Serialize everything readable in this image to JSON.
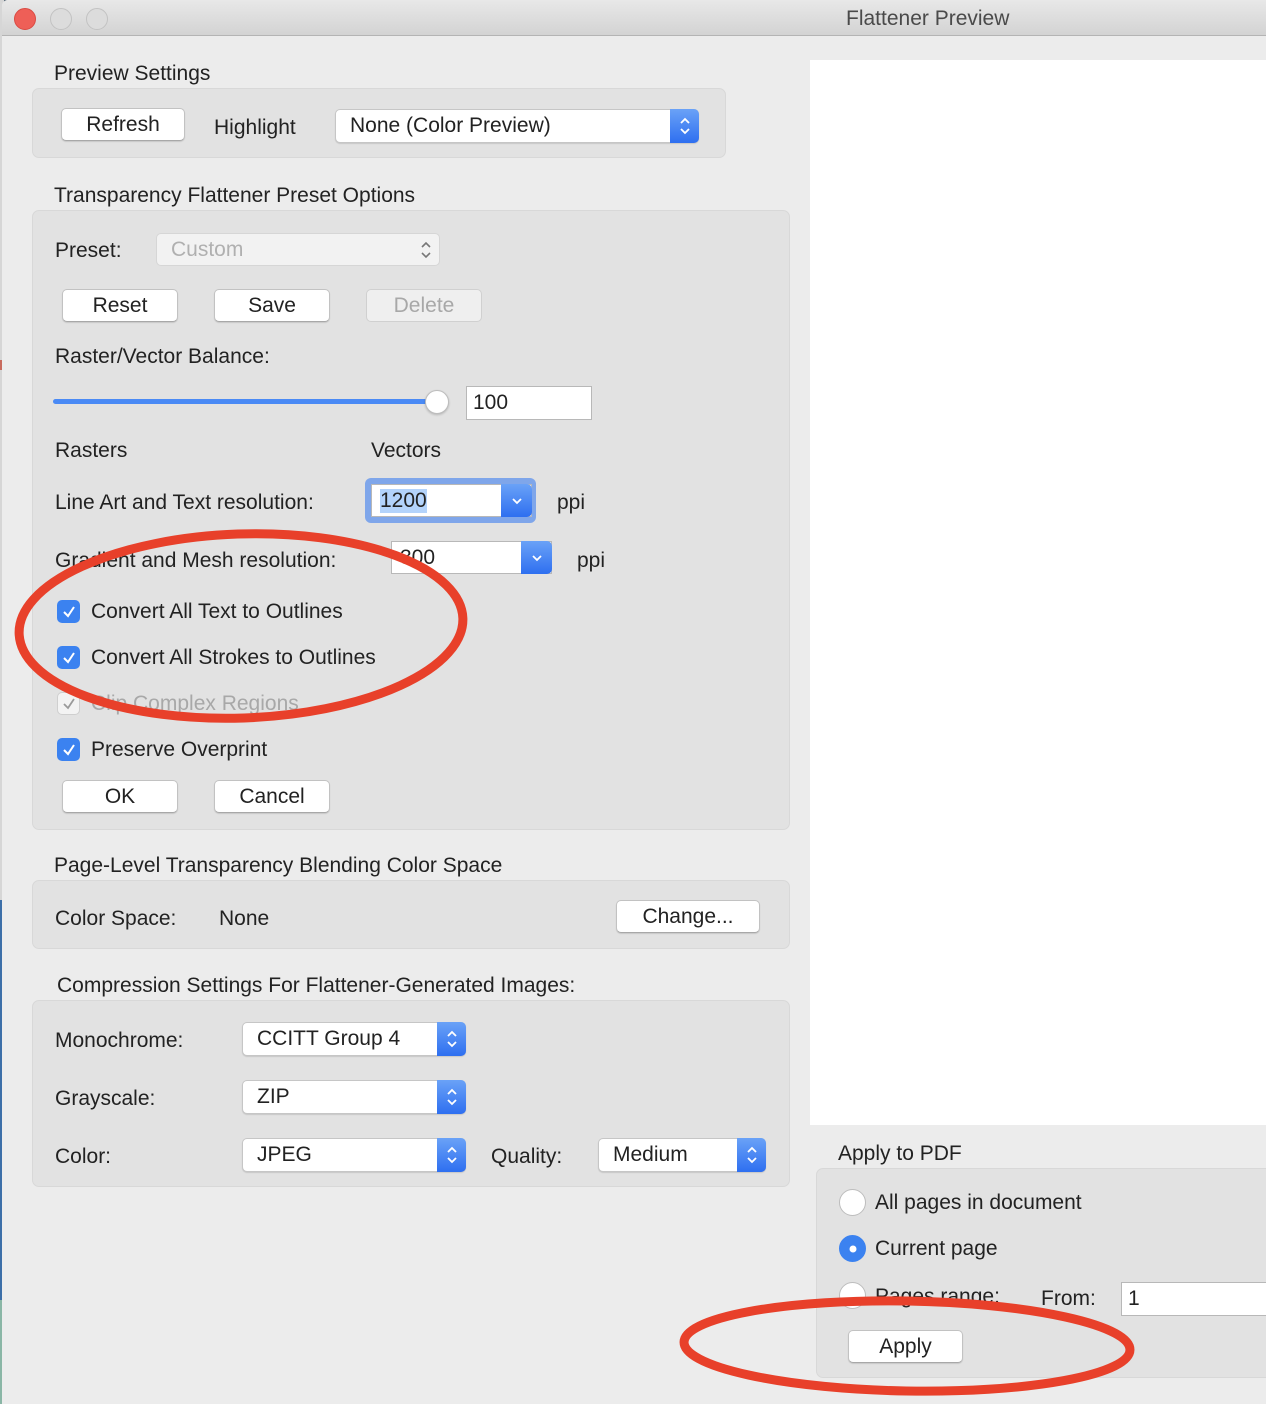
{
  "window": {
    "title": "Flattener Preview"
  },
  "preview_settings": {
    "section_label": "Preview Settings",
    "refresh_label": "Refresh",
    "highlight_label": "Highlight",
    "highlight_value": "None (Color Preview)"
  },
  "preset_options": {
    "section_label": "Transparency Flattener Preset Options",
    "preset_label": "Preset:",
    "preset_value": "Custom",
    "reset_label": "Reset",
    "save_label": "Save",
    "delete_label": "Delete",
    "balance_label": "Raster/Vector Balance:",
    "balance_value": "100",
    "balance_percent": 100,
    "rasters_label": "Rasters",
    "vectors_label": "Vectors",
    "line_art_label": "Line Art and Text resolution:",
    "line_art_value": "1200",
    "line_art_unit": "ppi",
    "gradient_label": "Gradient and Mesh resolution:",
    "gradient_value": "300",
    "gradient_unit": "ppi",
    "checkboxes": [
      {
        "label": "Convert All Text to Outlines",
        "checked": true,
        "enabled": true
      },
      {
        "label": "Convert All Strokes to Outlines",
        "checked": true,
        "enabled": true
      },
      {
        "label": "Clip Complex Regions",
        "checked": true,
        "enabled": false
      },
      {
        "label": "Preserve Overprint",
        "checked": true,
        "enabled": true
      }
    ],
    "ok_label": "OK",
    "cancel_label": "Cancel"
  },
  "color_space": {
    "section_label": "Page-Level Transparency Blending Color Space",
    "label": "Color Space:",
    "value": "None",
    "change_label": "Change..."
  },
  "compression": {
    "section_label": "Compression Settings For Flattener-Generated Images:",
    "monochrome_label": "Monochrome:",
    "monochrome_value": "CCITT Group 4",
    "grayscale_label": "Grayscale:",
    "grayscale_value": "ZIP",
    "color_label": "Color:",
    "color_value": "JPEG",
    "quality_label": "Quality:",
    "quality_value": "Medium"
  },
  "apply_to_pdf": {
    "section_label": "Apply to PDF",
    "options": [
      {
        "label": "All pages in document",
        "selected": false
      },
      {
        "label": "Current page",
        "selected": true
      },
      {
        "label": "Pages range:",
        "selected": false
      }
    ],
    "from_label": "From:",
    "from_value": "1",
    "apply_label": "Apply"
  },
  "colors": {
    "accent": "#3b82f0",
    "annotation": "#e8402a"
  }
}
